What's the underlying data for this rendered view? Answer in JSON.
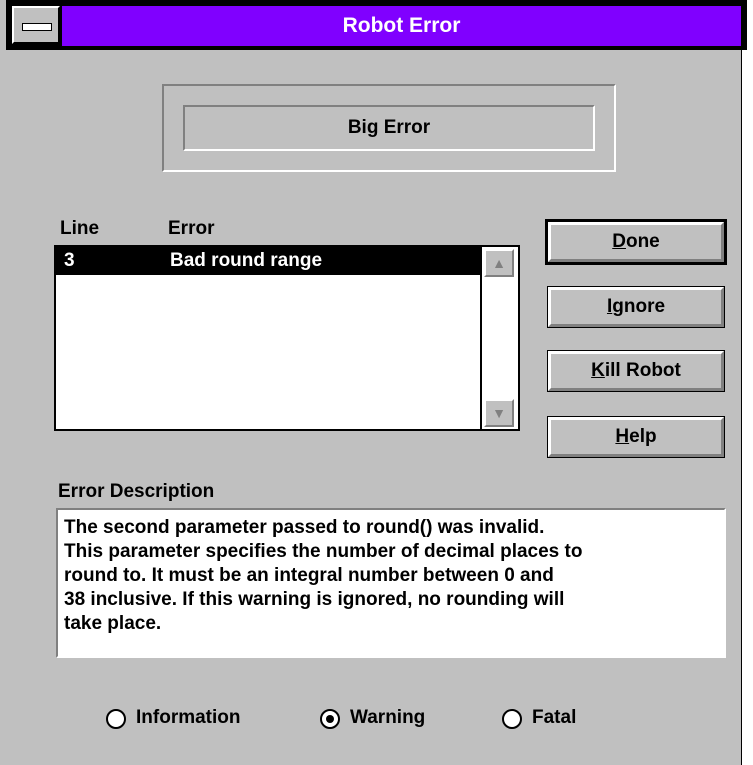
{
  "window": {
    "title": "Robot Error"
  },
  "error_title": "Big Error",
  "list": {
    "columns": [
      "Line",
      "Error"
    ],
    "rows": [
      {
        "line": "3",
        "error": "Bad round range"
      }
    ],
    "scroll_up_icon": "arrow-up-icon",
    "scroll_down_icon": "arrow-down-icon"
  },
  "buttons": {
    "done": {
      "mnemonic": "D",
      "rest": "one"
    },
    "ignore": {
      "mnemonic": "I",
      "rest": "gnore"
    },
    "kill": {
      "mnemonic": "K",
      "rest": "ill Robot"
    },
    "help": {
      "mnemonic": "H",
      "rest": "elp"
    }
  },
  "description": {
    "label": "Error Description",
    "lines": [
      "The second parameter passed to round() was invalid.",
      "This parameter specifies the number of decimal places to",
      "round to.  It must be an integral number between 0 and",
      "38 inclusive.  If this warning is ignored, no rounding will",
      "take place."
    ]
  },
  "severity": {
    "options": [
      "Information",
      "Warning",
      "Fatal"
    ],
    "selected": "Warning"
  },
  "colors": {
    "caption": "#8000ff",
    "face": "#c0c0c0"
  }
}
